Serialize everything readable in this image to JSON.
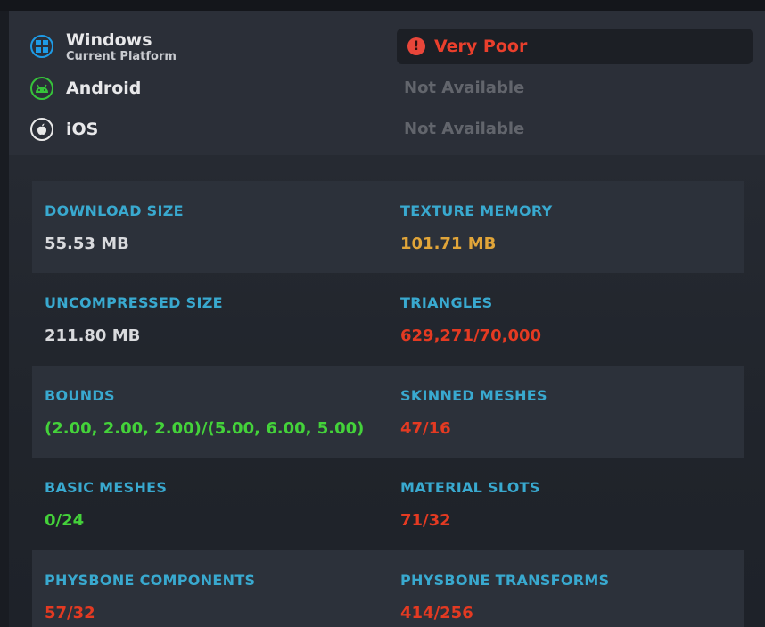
{
  "platforms": {
    "windows": {
      "name": "Windows",
      "subtitle": "Current Platform",
      "icon": "windows-icon"
    },
    "android": {
      "name": "Android",
      "status": "Not Available",
      "icon": "android-icon"
    },
    "ios": {
      "name": "iOS",
      "status": "Not Available",
      "icon": "apple-icon"
    }
  },
  "rating": {
    "label": "Very Poor",
    "icon": "alert-icon",
    "color": "#ea3f2c"
  },
  "stats": [
    {
      "label": "DOWNLOAD SIZE",
      "value": "55.53 MB",
      "color": "white"
    },
    {
      "label": "TEXTURE MEMORY",
      "value": "101.71 MB",
      "color": "yellow"
    },
    {
      "label": "UNCOMPRESSED SIZE",
      "value": "211.80 MB",
      "color": "white"
    },
    {
      "label": "TRIANGLES",
      "value": "629,271/70,000",
      "color": "red"
    },
    {
      "label": "BOUNDS",
      "value": "(2.00, 2.00, 2.00)/(5.00, 6.00, 5.00)",
      "color": "green"
    },
    {
      "label": "SKINNED MESHES",
      "value": "47/16",
      "color": "red"
    },
    {
      "label": "BASIC MESHES",
      "value": "0/24",
      "color": "green"
    },
    {
      "label": "MATERIAL SLOTS",
      "value": "71/32",
      "color": "red"
    },
    {
      "label": "PHYSBONE COMPONENTS",
      "value": "57/32",
      "color": "red"
    },
    {
      "label": "PHYSBONE TRANSFORMS",
      "value": "414/256",
      "color": "red"
    }
  ],
  "colors": {
    "label": "#39a9cf",
    "white": "#d9dadd",
    "yellow": "#e1a539",
    "red": "#e43a22",
    "green": "#44d23a"
  }
}
